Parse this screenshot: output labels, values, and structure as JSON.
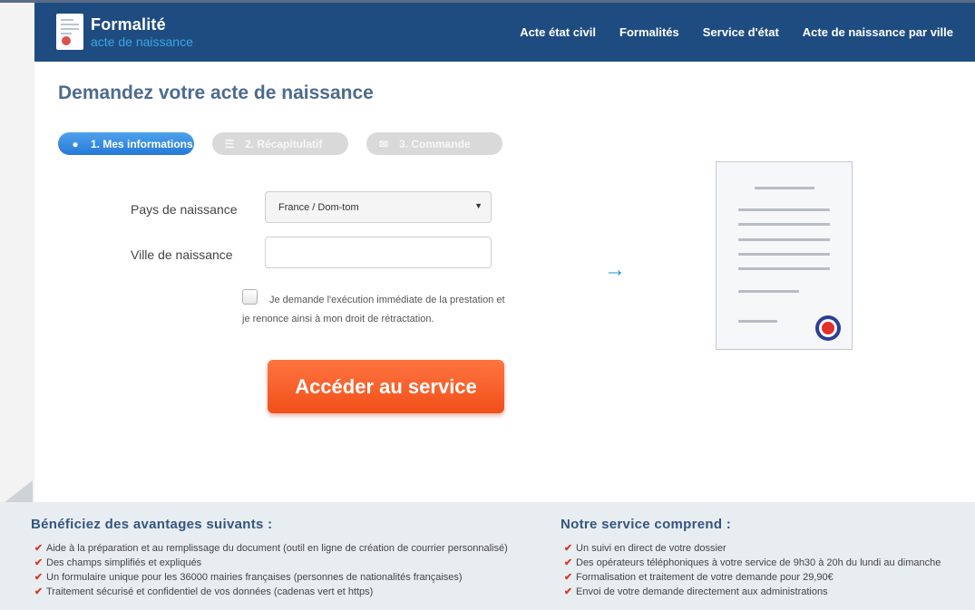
{
  "header": {
    "logo_title": "Formalité",
    "logo_subtitle": "acte de naissance",
    "nav": [
      "Acte état civil",
      "Formalités",
      "Service d'état",
      "Acte de naissance par ville"
    ]
  },
  "page_title": "Demandez votre acte de naissance",
  "steps": [
    {
      "label": "1. Mes informations",
      "icon": "user-icon",
      "active": true
    },
    {
      "label": "2. Récapitulatif",
      "icon": "list-icon",
      "active": false
    },
    {
      "label": "3. Commande",
      "icon": "envelope-icon",
      "active": false
    }
  ],
  "form": {
    "country_label": "Pays de naissance",
    "country_value": "France / Dom-tom",
    "city_label": "Ville de naissance",
    "city_value": "",
    "consent_line1": "Je demande l'exécution immédiate de la prestation et",
    "consent_line2": "je renonce ainsi à mon droit de rétractation.",
    "consent_checked": false,
    "submit_label": "Accéder au service"
  },
  "footer": {
    "benefits_title": "Bénéficiez des avantages suivants :",
    "benefits": [
      "Aide à la préparation et au remplissage du document (outil en ligne de création de courrier personnalisé)",
      "Des champs simplifiés et expliqués",
      "Un formulaire unique pour les 36000 mairies françaises (personnes de nationalités françaises)",
      "Traitement sécurisé et confidentiel de vos données (cadenas vert et https)"
    ],
    "service_title": "Notre service comprend :",
    "service": [
      "Un suivi en direct de votre dossier",
      "Des opérateurs téléphoniques à votre service de 9h30 à 20h du lundi au dimanche",
      "Formalisation et traitement de votre demande pour 29,90€",
      "Envoi de votre demande directement aux administrations"
    ]
  },
  "colors": {
    "header_bg": "#1f4c80",
    "accent_blue": "#2579d6",
    "cta_orange": "#f15019",
    "check_red": "#d83a2a"
  }
}
